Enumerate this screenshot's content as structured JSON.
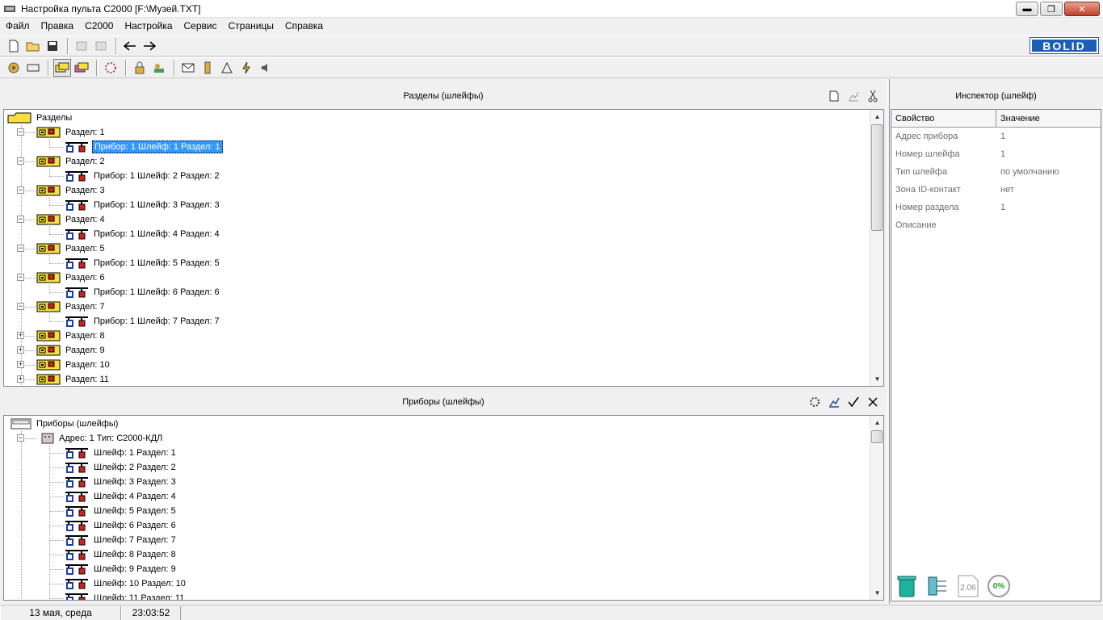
{
  "window": {
    "title": "Настройка пульта С2000 [F:\\Музей.TXT]",
    "minimize": "▬",
    "restore": "❐",
    "close": "✕"
  },
  "menu": [
    "Файл",
    "Правка",
    "С2000",
    "Настройка",
    "Сервис",
    "Страницы",
    "Справка"
  ],
  "brand": "BOLID",
  "sections_panel": {
    "title": "Разделы (шлейфы)",
    "root": "Разделы",
    "items": [
      {
        "label": "Раздел: 1",
        "expanded": true,
        "child": "Прибор: 1 Шлейф: 1 Раздел: 1",
        "selected": true
      },
      {
        "label": "Раздел: 2",
        "expanded": true,
        "child": "Прибор: 1 Шлейф: 2 Раздел: 2"
      },
      {
        "label": "Раздел: 3",
        "expanded": true,
        "child": "Прибор: 1 Шлейф: 3 Раздел: 3"
      },
      {
        "label": "Раздел: 4",
        "expanded": true,
        "child": "Прибор: 1 Шлейф: 4 Раздел: 4"
      },
      {
        "label": "Раздел: 5",
        "expanded": true,
        "child": "Прибор: 1 Шлейф: 5 Раздел: 5"
      },
      {
        "label": "Раздел: 6",
        "expanded": true,
        "child": "Прибор: 1 Шлейф: 6 Раздел: 6"
      },
      {
        "label": "Раздел: 7",
        "expanded": true,
        "child": "Прибор: 1 Шлейф: 7 Раздел: 7"
      },
      {
        "label": "Раздел: 8",
        "expanded": false
      },
      {
        "label": "Раздел: 9",
        "expanded": false
      },
      {
        "label": "Раздел: 10",
        "expanded": false
      },
      {
        "label": "Раздел: 11",
        "expanded": false
      }
    ]
  },
  "devices_panel": {
    "title": "Приборы  (шлейфы)",
    "root": "Приборы (шлейфы)",
    "device": "Адрес: 1 Тип: С2000-КДЛ",
    "loops": [
      "Шлейф: 1 Раздел: 1",
      "Шлейф: 2 Раздел: 2",
      "Шлейф: 3 Раздел: 3",
      "Шлейф: 4 Раздел: 4",
      "Шлейф: 5 Раздел: 5",
      "Шлейф: 6 Раздел: 6",
      "Шлейф: 7 Раздел: 7",
      "Шлейф: 8 Раздел: 8",
      "Шлейф: 9 Раздел: 9",
      "Шлейф: 10 Раздел: 10",
      "Шлейф: 11 Раздел: 11"
    ]
  },
  "inspector": {
    "title": "Инспектор (шлейф)",
    "col_property": "Свойство",
    "col_value": "Значение",
    "rows": [
      {
        "k": "Адрес прибора",
        "v": "1"
      },
      {
        "k": "Номер шлейфа",
        "v": "1"
      },
      {
        "k": "Тип шлейфа",
        "v": "по умолчанию"
      },
      {
        "k": "Зона ID-контакт",
        "v": "нет"
      },
      {
        "k": "Номер раздела",
        "v": "1"
      },
      {
        "k": "Описание",
        "v": ""
      }
    ],
    "version": "2.06",
    "progress": "0%"
  },
  "status": {
    "date": "13 мая, среда",
    "time": "23:03:52"
  }
}
